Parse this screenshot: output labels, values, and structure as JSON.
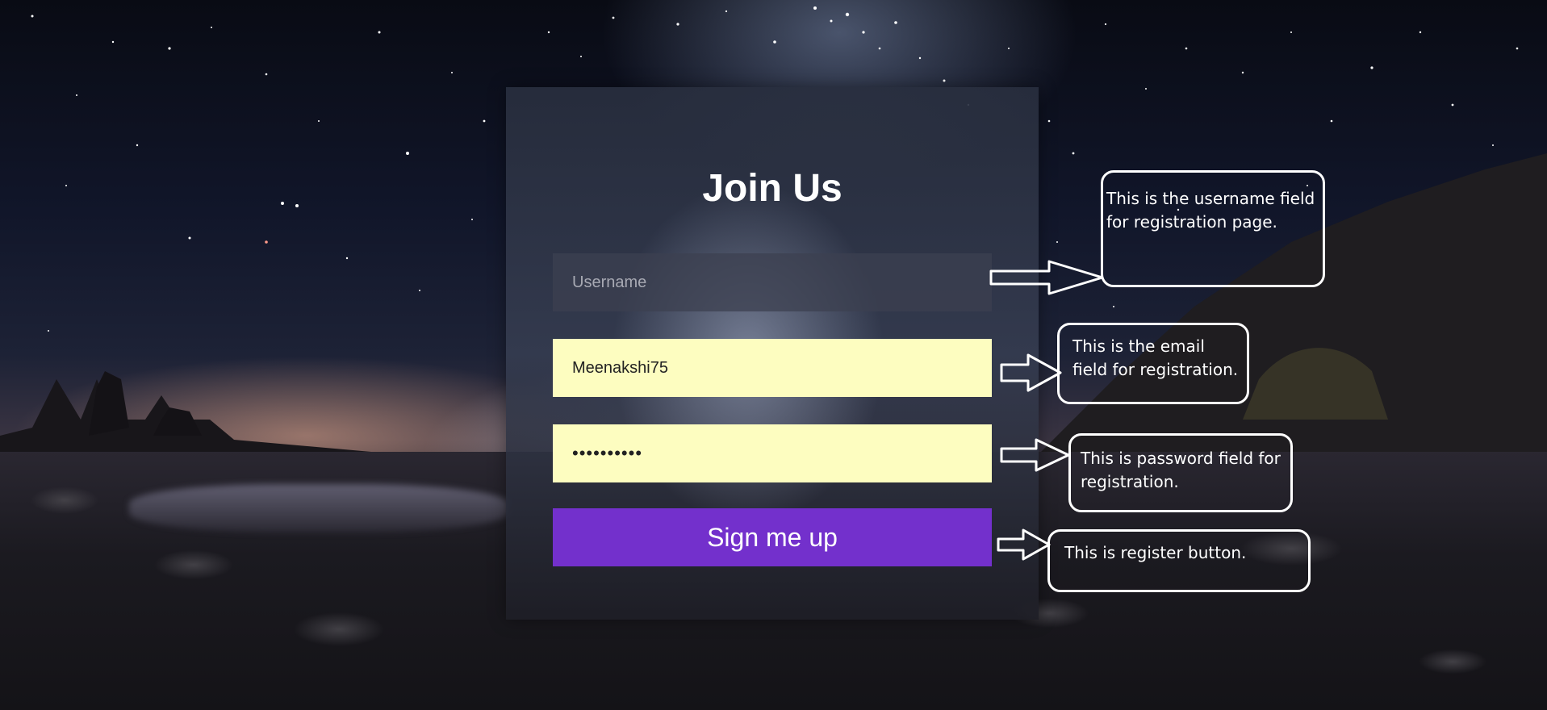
{
  "form": {
    "title": "Join Us",
    "username": {
      "placeholder": "Username",
      "value": ""
    },
    "email": {
      "value": "Meenakshi75"
    },
    "password": {
      "masked_value": "••••••••••"
    },
    "submit_label": "Sign me up",
    "colors": {
      "autofill_background": "#fdfdc0",
      "button_background": "#7330cc",
      "title_color": "#ffffff"
    }
  },
  "annotations": {
    "username": {
      "lines": [
        "This is the username field",
        "for registration page."
      ]
    },
    "email": {
      "lines": [
        "This is the email",
        "field for registration."
      ]
    },
    "password": {
      "lines": [
        "This is password field for",
        "registration."
      ]
    },
    "register": {
      "lines": [
        "This is register button."
      ]
    }
  },
  "background": {
    "description_icon": "night-sky-icon"
  }
}
